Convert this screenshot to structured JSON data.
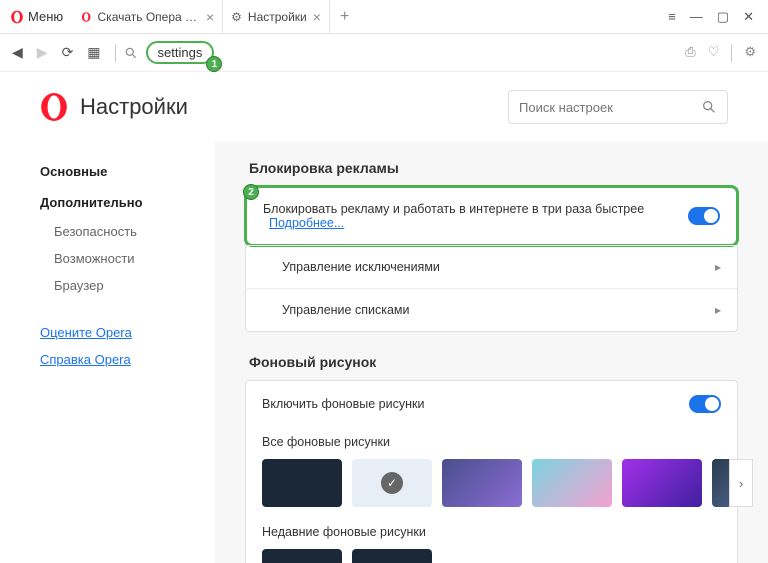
{
  "titlebar": {
    "menu": "Меню",
    "tabs": [
      {
        "label": "Скачать Опера для комп"
      },
      {
        "label": "Настройки",
        "active": true
      }
    ]
  },
  "toolbar": {
    "address": "settings",
    "marker1": "1"
  },
  "header": {
    "title": "Настройки",
    "search_placeholder": "Поиск настроек"
  },
  "sidebar": {
    "basic": "Основные",
    "advanced": "Дополнительно",
    "sub": [
      "Безопасность",
      "Возможности",
      "Браузер"
    ],
    "links": [
      "Оцените Opera",
      "Справка Opera"
    ]
  },
  "sections": {
    "adblock": {
      "title": "Блокировка рекламы",
      "row1": "Блокировать рекламу и работать в интернете в три раза быстрее",
      "learn": "Подробнее...",
      "marker2": "2",
      "row2": "Управление исключениями",
      "row3": "Управление списками"
    },
    "wallpaper": {
      "title": "Фоновый рисунок",
      "enable": "Включить фоновые рисунки",
      "all": "Все фоновые рисунки",
      "recent": "Недавние фоновые рисунки"
    }
  },
  "wallpaper_colors": [
    "#1b2838",
    "#e8eef5",
    "#4a4e8c",
    "#7dd3e0",
    "#a030e8",
    "#2b3a50"
  ],
  "recent_colors": [
    "#1b2838",
    "#1b2838"
  ]
}
